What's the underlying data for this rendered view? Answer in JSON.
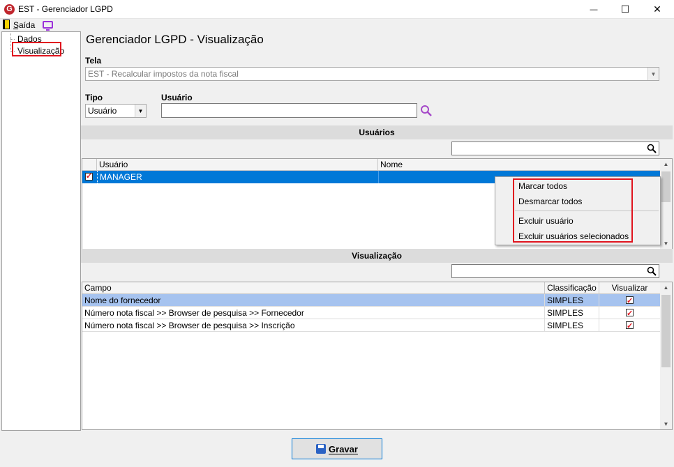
{
  "window": {
    "title": "EST - Gerenciador LGPD",
    "icon_letter": "G",
    "minimize": "—",
    "maximize": "☐",
    "close": "✕"
  },
  "menu": {
    "exit_label": "Saída"
  },
  "tree": {
    "items": [
      "Dados",
      "Visualização"
    ]
  },
  "main": {
    "title": "Gerenciador LGPD - Visualização",
    "tela_label": "Tela",
    "tela_value": "EST - Recalcular impostos da nota fiscal",
    "tipo_label": "Tipo",
    "tipo_value": "Usuário",
    "usuario_label": "Usuário",
    "usuario_value": ""
  },
  "users_section": {
    "title": "Usuários",
    "columns": [
      "Usuário",
      "Nome"
    ],
    "rows": [
      {
        "usuario": "MANAGER",
        "nome": "",
        "checked": true
      }
    ]
  },
  "context_menu": {
    "items": [
      "Marcar todos",
      "Desmarcar todos",
      "Excluir usuário",
      "Excluir usuários selecionados"
    ]
  },
  "visualizacao_section": {
    "title": "Visualização",
    "columns": [
      "Campo",
      "Classificação",
      "Visualizar"
    ],
    "rows": [
      {
        "campo": "Nome do fornecedor",
        "classificacao": "SIMPLES",
        "visualizar": true
      },
      {
        "campo": "Número nota fiscal >> Browser de pesquisa >> Fornecedor",
        "classificacao": "SIMPLES",
        "visualizar": true
      },
      {
        "campo": "Número nota fiscal >> Browser de pesquisa >> Inscrição",
        "classificacao": "SIMPLES",
        "visualizar": true
      }
    ]
  },
  "footer": {
    "save_label": "Gravar"
  },
  "colors": {
    "selection": "#0078d7",
    "highlight_row": "#a6c3ef",
    "annotation_red": "#e0141e"
  }
}
